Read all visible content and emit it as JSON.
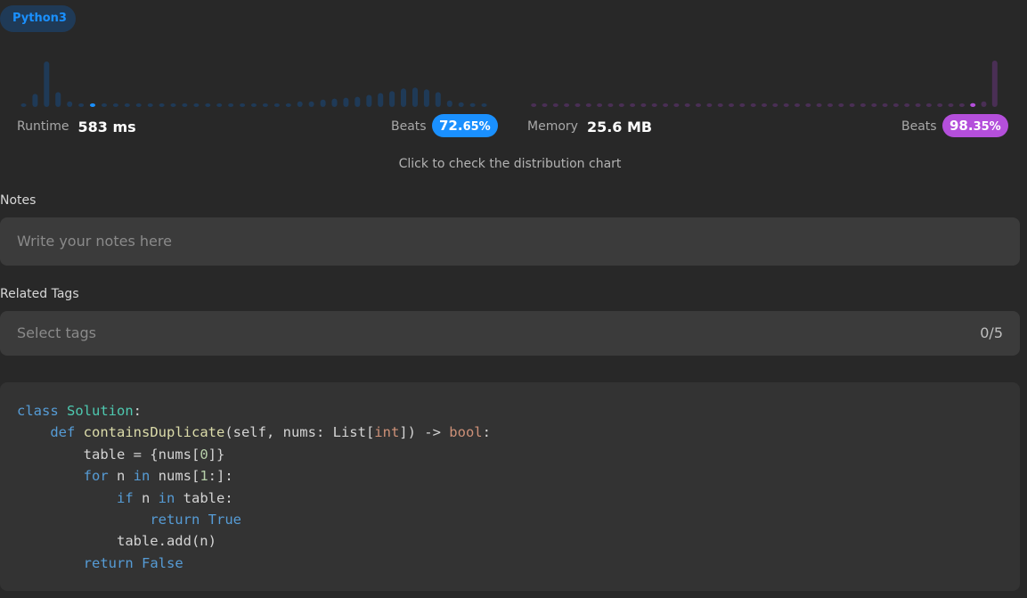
{
  "language": "Python3",
  "runtime": {
    "label": "Runtime",
    "value": "583 ms",
    "beats_label": "Beats",
    "beats_main": "72.",
    "beats_dec": "65%",
    "bars": [
      0.06,
      0.28,
      0.98,
      0.32,
      0.12,
      0.06,
      0.06,
      0.06,
      0.06,
      0.06,
      0.06,
      0.06,
      0.06,
      0.06,
      0.06,
      0.06,
      0.06,
      0.06,
      0.06,
      0.06,
      0.06,
      0.06,
      0.06,
      0.06,
      0.12,
      0.12,
      0.16,
      0.18,
      0.2,
      0.22,
      0.26,
      0.3,
      0.34,
      0.4,
      0.42,
      0.38,
      0.32,
      0.14,
      0.1,
      0.08,
      0.06
    ],
    "highlight_index": 6,
    "color": "#1a90ff",
    "bar_color": "#1f3a57"
  },
  "memory": {
    "label": "Memory",
    "value": "25.6 MB",
    "beats_label": "Beats",
    "beats_main": "98.",
    "beats_dec": "35%",
    "bars": [
      0.06,
      0.06,
      0.06,
      0.06,
      0.06,
      0.06,
      0.06,
      0.06,
      0.06,
      0.06,
      0.06,
      0.06,
      0.06,
      0.06,
      0.06,
      0.06,
      0.06,
      0.06,
      0.06,
      0.06,
      0.06,
      0.06,
      0.06,
      0.06,
      0.06,
      0.06,
      0.06,
      0.06,
      0.06,
      0.06,
      0.06,
      0.06,
      0.06,
      0.06,
      0.06,
      0.06,
      0.06,
      0.06,
      0.06,
      0.06,
      0.08,
      0.12,
      1.0
    ],
    "highlight_index": 40,
    "color": "#b44fdb",
    "bar_color": "#4a2f55"
  },
  "distribution_link": "Click to check the distribution chart",
  "notes": {
    "label": "Notes",
    "placeholder": "Write your notes here"
  },
  "tags": {
    "label": "Related Tags",
    "placeholder": "Select tags",
    "count": "0/5"
  }
}
